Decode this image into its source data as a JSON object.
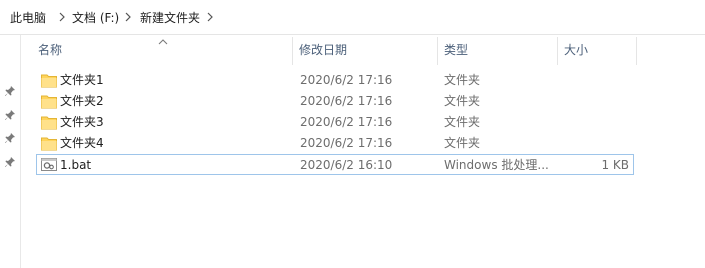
{
  "breadcrumb": {
    "items": [
      "此电脑",
      "文档 (F:)",
      "新建文件夹"
    ]
  },
  "columns": {
    "name": "名称",
    "date": "修改日期",
    "type": "类型",
    "size": "大小"
  },
  "files": [
    {
      "name": "文件夹1",
      "date": "2020/6/2 17:16",
      "type": "文件夹",
      "size": "",
      "icon": "folder-icon"
    },
    {
      "name": "文件夹2",
      "date": "2020/6/2 17:16",
      "type": "文件夹",
      "size": "",
      "icon": "folder-icon"
    },
    {
      "name": "文件夹3",
      "date": "2020/6/2 17:16",
      "type": "文件夹",
      "size": "",
      "icon": "folder-icon"
    },
    {
      "name": "文件夹4",
      "date": "2020/6/2 17:16",
      "type": "文件夹",
      "size": "",
      "icon": "folder-icon"
    },
    {
      "name": "1.bat",
      "date": "2020/6/2 16:10",
      "type": "Windows 批处理...",
      "size": "1 KB",
      "icon": "batch-file-icon"
    }
  ],
  "colors": {
    "folder": "#ffd45b",
    "header_text": "#4c607a",
    "focus_border": "#9ec5ea"
  }
}
